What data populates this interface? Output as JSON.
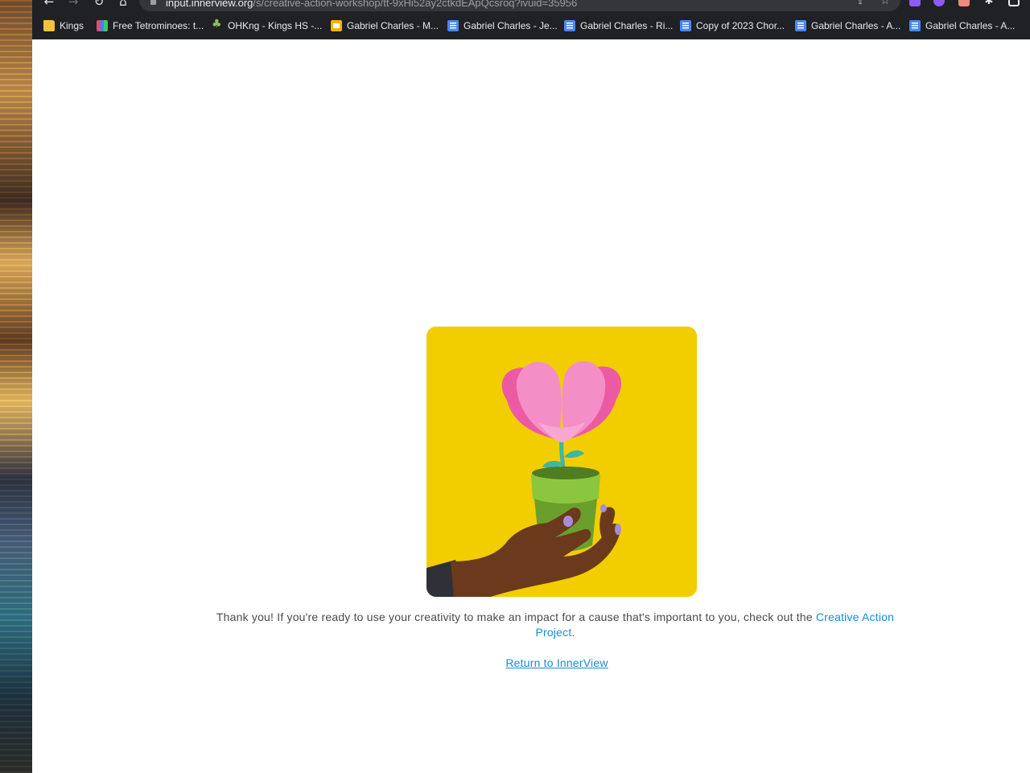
{
  "browser": {
    "url_host": "input.innerview.org",
    "url_path": "/s/creative-action-workshop/tt-9xHi52ay2ctkdEApQcsroq?ivuid=35956"
  },
  "bookmarks": [
    {
      "label": "Kings",
      "icon": "folder-icon"
    },
    {
      "label": "Free Tetrominoes: t...",
      "icon": "tetris-icon"
    },
    {
      "label": "OHKng - Kings HS -...",
      "icon": "leaf-icon"
    },
    {
      "label": "Gabriel Charles - M...",
      "icon": "slides-icon"
    },
    {
      "label": "Gabriel Charles - Je...",
      "icon": "docs-icon"
    },
    {
      "label": "Gabriel Charles - Ri...",
      "icon": "docs-icon"
    },
    {
      "label": "Copy of 2023 Chor...",
      "icon": "docs-icon"
    },
    {
      "label": "Gabriel Charles - A...",
      "icon": "docs-icon"
    },
    {
      "label": "Gabriel Charles - A...",
      "icon": "docs-icon"
    }
  ],
  "content": {
    "thanks_text": "Thank you! If you're ready to use your creativity to make an impact for a cause that's important to you, check out the",
    "creative_action_link": "Creative Action Project",
    "period": ".",
    "return_link": "Return to InnerView"
  },
  "colors": {
    "illustration_bg": "#f2cd00",
    "link": "#1a8bd8",
    "petal_pink": "#f07ab4",
    "pot_green": "#6fae3a"
  }
}
